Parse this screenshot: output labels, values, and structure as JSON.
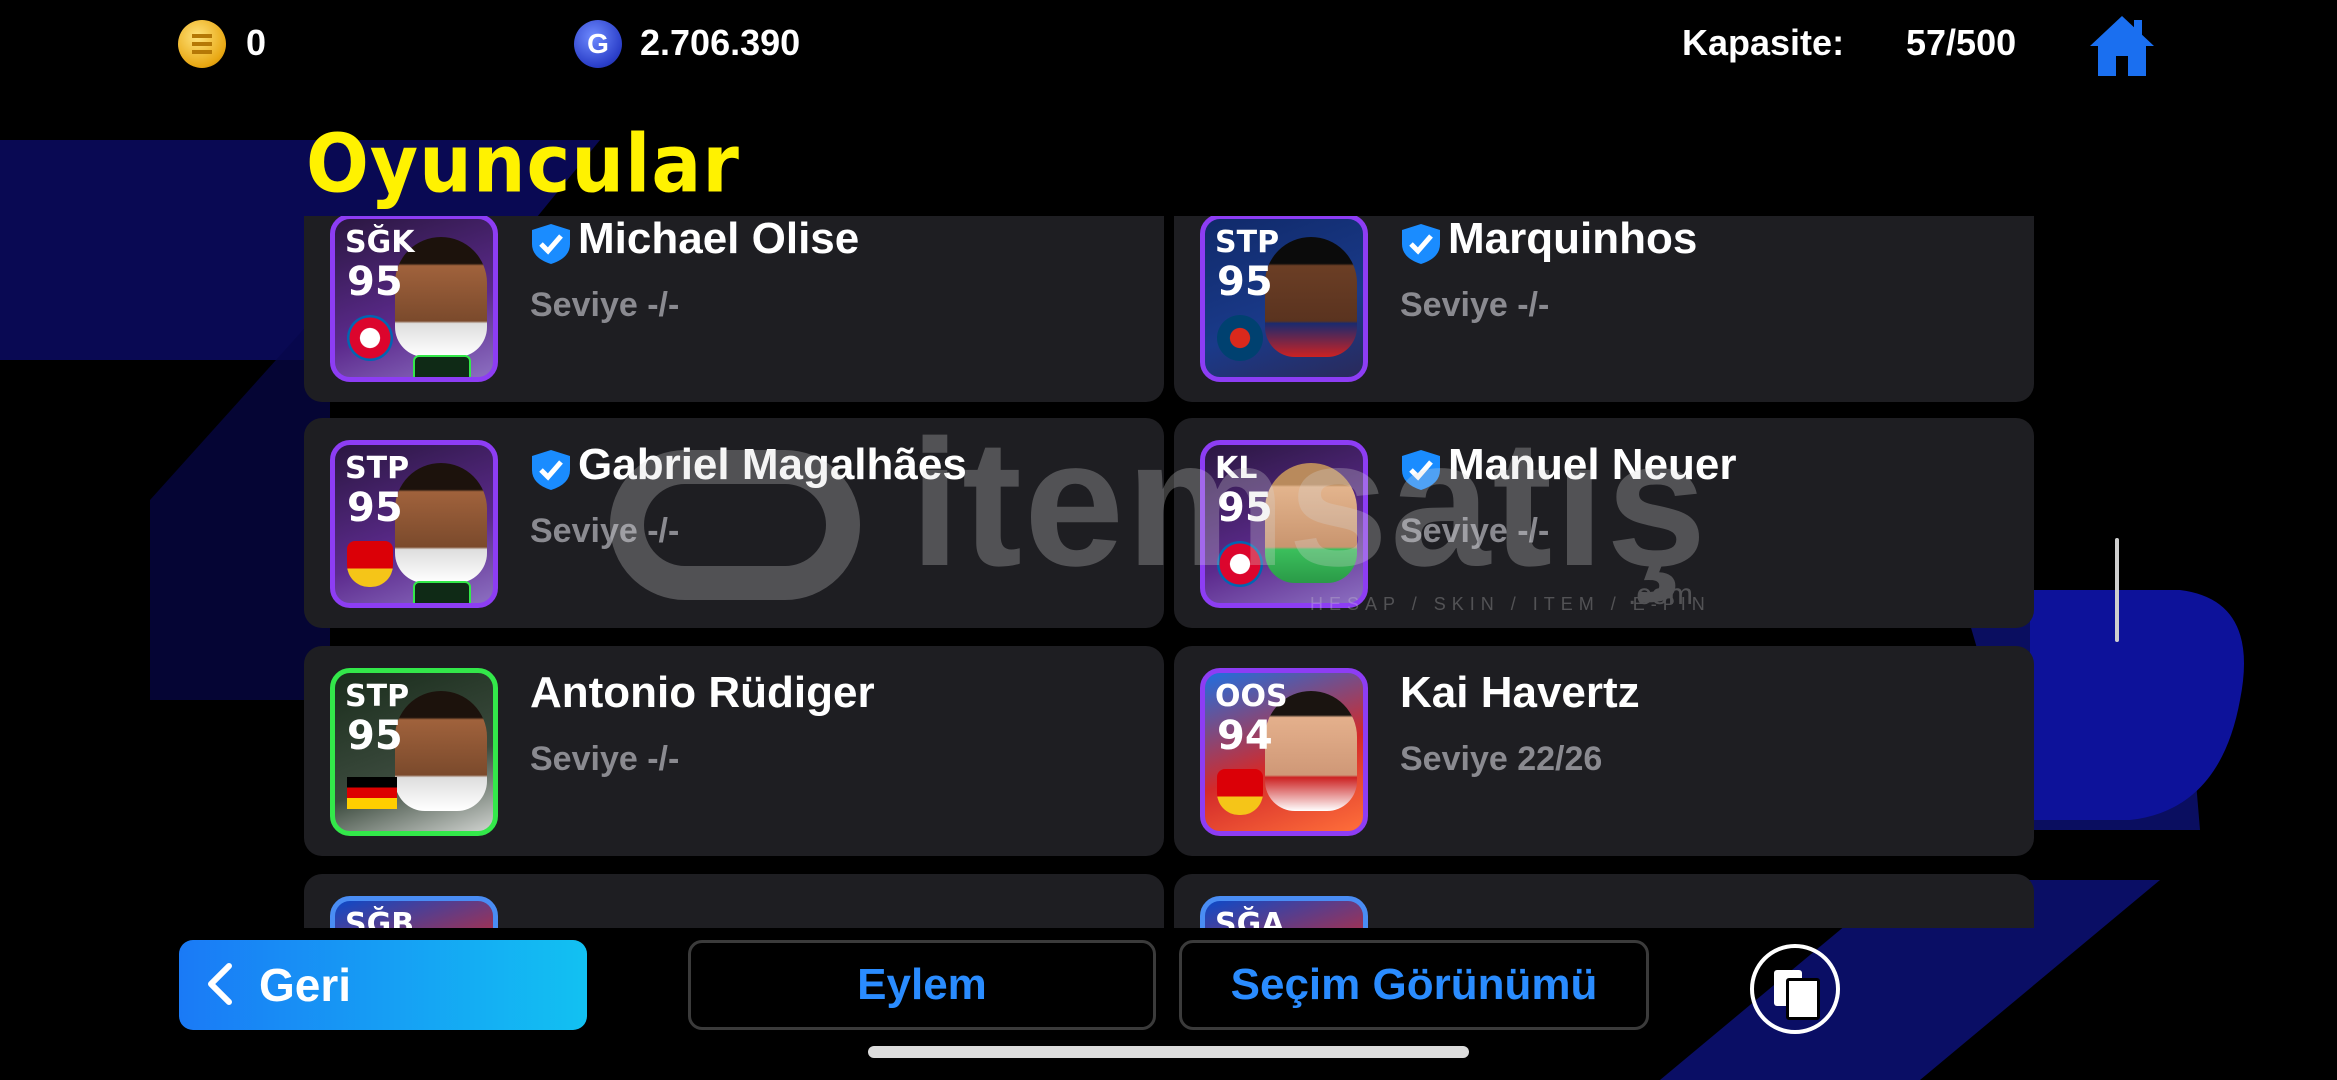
{
  "currency": {
    "coins_value": "0",
    "gp_value": "2.706.390",
    "gp_symbol": "G"
  },
  "capacity": {
    "label": "Kapasite:",
    "value": "57/500"
  },
  "page_title": "Oyuncular",
  "players": [
    {
      "name": "Michael Olise",
      "position": "SĞK",
      "rating": "95",
      "level": "Seviye -/-",
      "club": "fcb",
      "verified": true
    },
    {
      "name": "Marquinhos",
      "position": "STP",
      "rating": "95",
      "level": "Seviye -/-",
      "club": "psg",
      "verified": true
    },
    {
      "name": "Gabriel Magalhães",
      "position": "STP",
      "rating": "95",
      "level": "Seviye -/-",
      "club": "ars",
      "verified": true
    },
    {
      "name": "Manuel Neuer",
      "position": "KL",
      "rating": "95",
      "level": "Seviye -/-",
      "club": "fcb",
      "verified": true
    },
    {
      "name": "Antonio Rüdiger",
      "position": "STP",
      "rating": "95",
      "level": "Seviye -/-",
      "club": "germany",
      "verified": false
    },
    {
      "name": "Kai Havertz",
      "position": "OOS",
      "rating": "94",
      "level": "Seviye 22/26",
      "club": "ars",
      "verified": false
    },
    {
      "position": "SĞB"
    },
    {
      "position": "SĞA"
    }
  ],
  "watermark": {
    "text": "itemsatış",
    "subtext": "HESAP / SKIN / ITEM / E-PIN",
    "domain": ".com"
  },
  "bottom_bar": {
    "back_label": "Geri",
    "action_label": "Eylem",
    "selection_view_label": "Seçim Görünümü"
  },
  "colors": {
    "title_yellow": "#fff200",
    "accent_blue": "#2a8cff",
    "card_bg": "#1e1e22"
  },
  "icons": [
    "gold-coin-icon",
    "gp-coin-icon",
    "home-icon",
    "verified-icon",
    "chevron-left-icon",
    "copy-icon"
  ]
}
